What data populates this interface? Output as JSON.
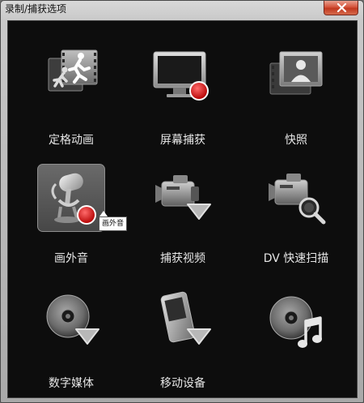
{
  "window": {
    "title": "录制/捕获选项"
  },
  "tiles": [
    {
      "label": "定格动画",
      "icon": "stop-motion-icon"
    },
    {
      "label": "屏幕捕获",
      "icon": "screen-capture-icon"
    },
    {
      "label": "快照",
      "icon": "snapshot-icon"
    },
    {
      "label": "画外音",
      "icon": "voiceover-microphone-icon",
      "selected": true
    },
    {
      "label": "捕获视频",
      "icon": "capture-video-icon"
    },
    {
      "label": "DV 快速扫描",
      "icon": "dv-quick-scan-icon"
    },
    {
      "label": "数字媒体",
      "icon": "digital-media-disc-icon"
    },
    {
      "label": "移动设备",
      "icon": "mobile-device-icon"
    },
    {
      "label": "",
      "icon": "music-disc-icon"
    }
  ],
  "tooltip": {
    "text": "画外音"
  },
  "colors": {
    "record_red": "#d81b1b",
    "client_bg": "#0d0d0d",
    "label_text": "#e6e6e6"
  }
}
